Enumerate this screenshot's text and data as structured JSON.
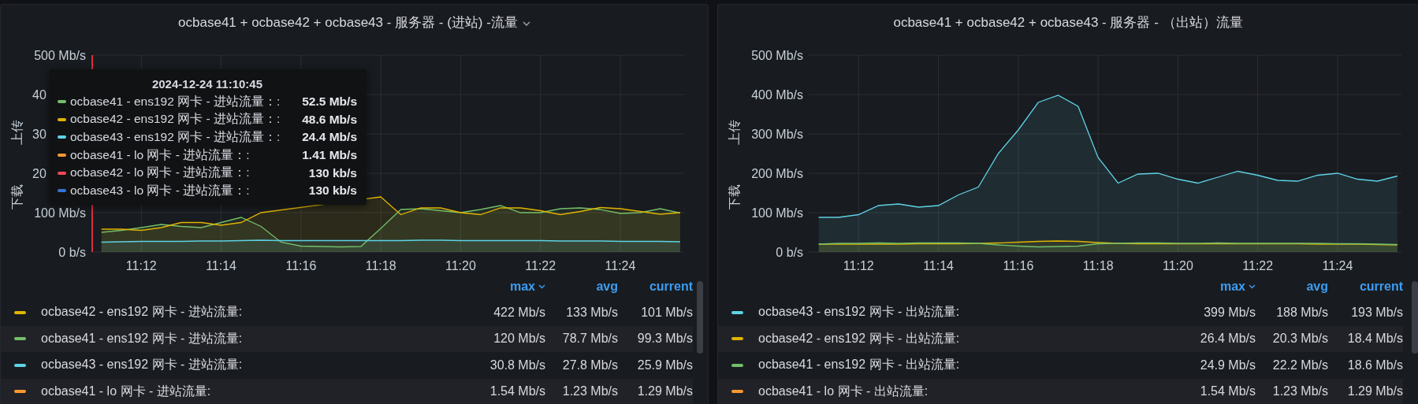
{
  "panels": [
    {
      "title": "ocbase41 + ocbase42 + ocbase43 - 服务器 - (进站) -流量",
      "has_menu": true,
      "upper_axis_label": "上传",
      "lower_axis_label": "下载",
      "covered_ytick_labels": [
        "40",
        "30",
        "20"
      ],
      "chart_data": {
        "type": "area",
        "grid": true,
        "categories": [
          null,
          null,
          "11:12",
          null,
          null,
          null,
          "11:14",
          null,
          null,
          null,
          "11:16",
          null,
          null,
          null,
          "11:18",
          null,
          null,
          null,
          "11:20",
          null,
          null,
          null,
          "11:22",
          null,
          null,
          null,
          "11:24",
          null,
          null,
          null
        ],
        "ylim": [
          0,
          500
        ],
        "yticks": [
          {
            "value": 0,
            "label": "0 b/s"
          },
          {
            "value": 100,
            "label": "100 Mb/s"
          },
          {
            "value": 500,
            "label": "500 Mb/s"
          }
        ],
        "series": [
          {
            "color": "#73bf69",
            "values": [
              50,
              55,
              62,
              70,
              65,
              62,
              75,
              88,
              65,
              25,
              15,
              14,
              13,
              14,
              60,
              108,
              110,
              105,
              100,
              108,
              118,
              100,
              100,
              110,
              112,
              108,
              98,
              100,
              110,
              99
            ]
          },
          {
            "color": "#e0b400",
            "values": [
              58,
              58,
              55,
              62,
              75,
              75,
              68,
              75,
              100,
              null,
              null,
              null,
              null,
              null,
              140,
              95,
              112,
              112,
              100,
              95,
              112,
              112,
              105,
              95,
              103,
              113,
              110,
              103,
              96,
              100
            ]
          },
          {
            "color": "#5ed2e6",
            "values": [
              25,
              26,
              27,
              27,
              27,
              28,
              28,
              29,
              30,
              29,
              29,
              29,
              29,
              29,
              29,
              29,
              30,
              30,
              29,
              29,
              29,
              29,
              29,
              28,
              28,
              28,
              27,
              27,
              27,
              26
            ]
          }
        ]
      },
      "tooltip": {
        "title": "2024-12-24 11:10:45",
        "rows": [
          {
            "color": "#73bf69",
            "name": "ocbase41 - ens192 网卡 - 进站流量：:",
            "value": "52.5 Mb/s"
          },
          {
            "color": "#e0b400",
            "name": "ocbase42 - ens192 网卡 - 进站流量：:",
            "value": "48.6 Mb/s"
          },
          {
            "color": "#5ed2e6",
            "name": "ocbase43 - ens192 网卡 - 进站流量：:",
            "value": "24.4 Mb/s"
          },
          {
            "color": "#ff9830",
            "name": "ocbase41 - lo 网卡 - 进站流量：:",
            "value": "1.41 Mb/s"
          },
          {
            "color": "#f2495c",
            "name": "ocbase42 - lo 网卡 - 进站流量：:",
            "value": "130 kb/s"
          },
          {
            "color": "#3274d9",
            "name": "ocbase43 - lo 网卡 - 进站流量：:",
            "value": "130 kb/s"
          }
        ]
      },
      "legend": {
        "columns": [
          {
            "label": "max",
            "sorted": true
          },
          {
            "label": "avg",
            "sorted": false
          },
          {
            "label": "current",
            "sorted": false
          }
        ],
        "rows": [
          {
            "color": "#e0b400",
            "name": "ocbase42 - ens192 网卡 - 进站流量:",
            "cells": [
              "422 Mb/s",
              "133 Mb/s",
              "101 Mb/s"
            ]
          },
          {
            "color": "#73bf69",
            "name": "ocbase41 - ens192 网卡 - 进站流量:",
            "cells": [
              "120 Mb/s",
              "78.7 Mb/s",
              "99.3 Mb/s"
            ]
          },
          {
            "color": "#5ed2e6",
            "name": "ocbase43 - ens192 网卡 - 进站流量:",
            "cells": [
              "30.8 Mb/s",
              "27.8 Mb/s",
              "25.9 Mb/s"
            ]
          },
          {
            "color": "#ff9830",
            "name": "ocbase41 - lo 网卡 - 进站流量:",
            "cells": [
              "1.54 Mb/s",
              "1.23 Mb/s",
              "1.29 Mb/s"
            ]
          }
        ]
      }
    },
    {
      "title": "ocbase41 + ocbase42 + ocbase43 - 服务器 - （出站）流量",
      "has_menu": false,
      "upper_axis_label": "上传",
      "lower_axis_label": "下载",
      "chart_data": {
        "type": "area",
        "grid": true,
        "categories": [
          null,
          null,
          "11:12",
          null,
          null,
          null,
          "11:14",
          null,
          null,
          null,
          "11:16",
          null,
          null,
          null,
          "11:18",
          null,
          null,
          null,
          "11:20",
          null,
          null,
          null,
          "11:22",
          null,
          null,
          null,
          "11:24",
          null,
          null,
          null
        ],
        "ylim": [
          0,
          500
        ],
        "yticks": [
          {
            "value": 0,
            "label": "0 b/s"
          },
          {
            "value": 100,
            "label": "100 Mb/s"
          },
          {
            "value": 200,
            "label": "200 Mb/s"
          },
          {
            "value": 300,
            "label": "300 Mb/s"
          },
          {
            "value": 400,
            "label": "400 Mb/s"
          },
          {
            "value": 500,
            "label": "500 Mb/s"
          }
        ],
        "series": [
          {
            "color": "#5ed2e6",
            "values": [
              88,
              88,
              95,
              118,
              122,
              114,
              118,
              145,
              165,
              250,
              310,
              380,
              398,
              370,
              240,
              175,
              198,
              200,
              185,
              175,
              190,
              205,
              195,
              182,
              180,
              195,
              200,
              185,
              180,
              193
            ]
          },
          {
            "color": "#e0b400",
            "values": [
              20,
              20,
              20,
              20,
              20,
              21,
              21,
              21,
              22,
              23,
              25,
              27,
              28,
              27,
              24,
              22,
              21,
              21,
              21,
              21,
              21,
              21,
              21,
              21,
              21,
              20,
              20,
              20,
              19,
              18
            ]
          },
          {
            "color": "#73bf69",
            "values": [
              20,
              22,
              22,
              23,
              22,
              23,
              23,
              23,
              22,
              18,
              15,
              13,
              14,
              15,
              21,
              22,
              23,
              23,
              22,
              22,
              23,
              22,
              22,
              22,
              22,
              22,
              21,
              21,
              20,
              19
            ]
          }
        ]
      },
      "legend": {
        "columns": [
          {
            "label": "max",
            "sorted": true
          },
          {
            "label": "avg",
            "sorted": false
          },
          {
            "label": "current",
            "sorted": false
          }
        ],
        "rows": [
          {
            "color": "#5ed2e6",
            "name": "ocbase43 - ens192 网卡 - 出站流量:",
            "cells": [
              "399 Mb/s",
              "188 Mb/s",
              "193 Mb/s"
            ]
          },
          {
            "color": "#e0b400",
            "name": "ocbase42 - ens192 网卡 - 出站流量:",
            "cells": [
              "26.4 Mb/s",
              "20.3 Mb/s",
              "18.4 Mb/s"
            ]
          },
          {
            "color": "#73bf69",
            "name": "ocbase41 - ens192 网卡 - 出站流量:",
            "cells": [
              "24.9 Mb/s",
              "22.2 Mb/s",
              "18.6 Mb/s"
            ]
          },
          {
            "color": "#ff9830",
            "name": "ocbase41 - lo 网卡 - 出站流量:",
            "cells": [
              "1.54 Mb/s",
              "1.23 Mb/s",
              "1.29 Mb/s"
            ]
          }
        ]
      }
    }
  ]
}
